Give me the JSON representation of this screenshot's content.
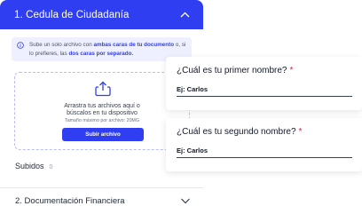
{
  "accordion": {
    "section1_title": "1. Cedula de Ciudadanía",
    "info": {
      "part1": "Sube un solo archivo con ",
      "part2": "ambas caras de tu documento",
      "part3": " o, si lo prefieres, las ",
      "part4": "dos caras por separado."
    },
    "dropzone": {
      "line1": "Arrastra tus archivos aquí o",
      "line2": "búscalos en tu dispositivo",
      "max_size": "Tamaño máximo por archivo: 20MG",
      "button_label": "Subir archivo"
    },
    "uploaded_label": "Subidos",
    "uploaded_count": "0",
    "section2_title": "2. Documentación Financiera"
  },
  "questions": [
    {
      "label": "¿Cuál es tu primer nombre?",
      "required_mark": "*",
      "placeholder": "Ej: Carlos"
    },
    {
      "label": "¿Cuál es tu segundo nombre?",
      "required_mark": "*",
      "placeholder": "Ej: Carlos"
    }
  ],
  "colors": {
    "accent": "#2f3ef0",
    "info_bg": "#eef0ff",
    "required": "#e11d48"
  },
  "icons": {
    "header_chevron": "chevron-up-icon",
    "info": "info-icon",
    "upload": "upload-icon",
    "section2_chevron": "chevron-down-icon"
  }
}
